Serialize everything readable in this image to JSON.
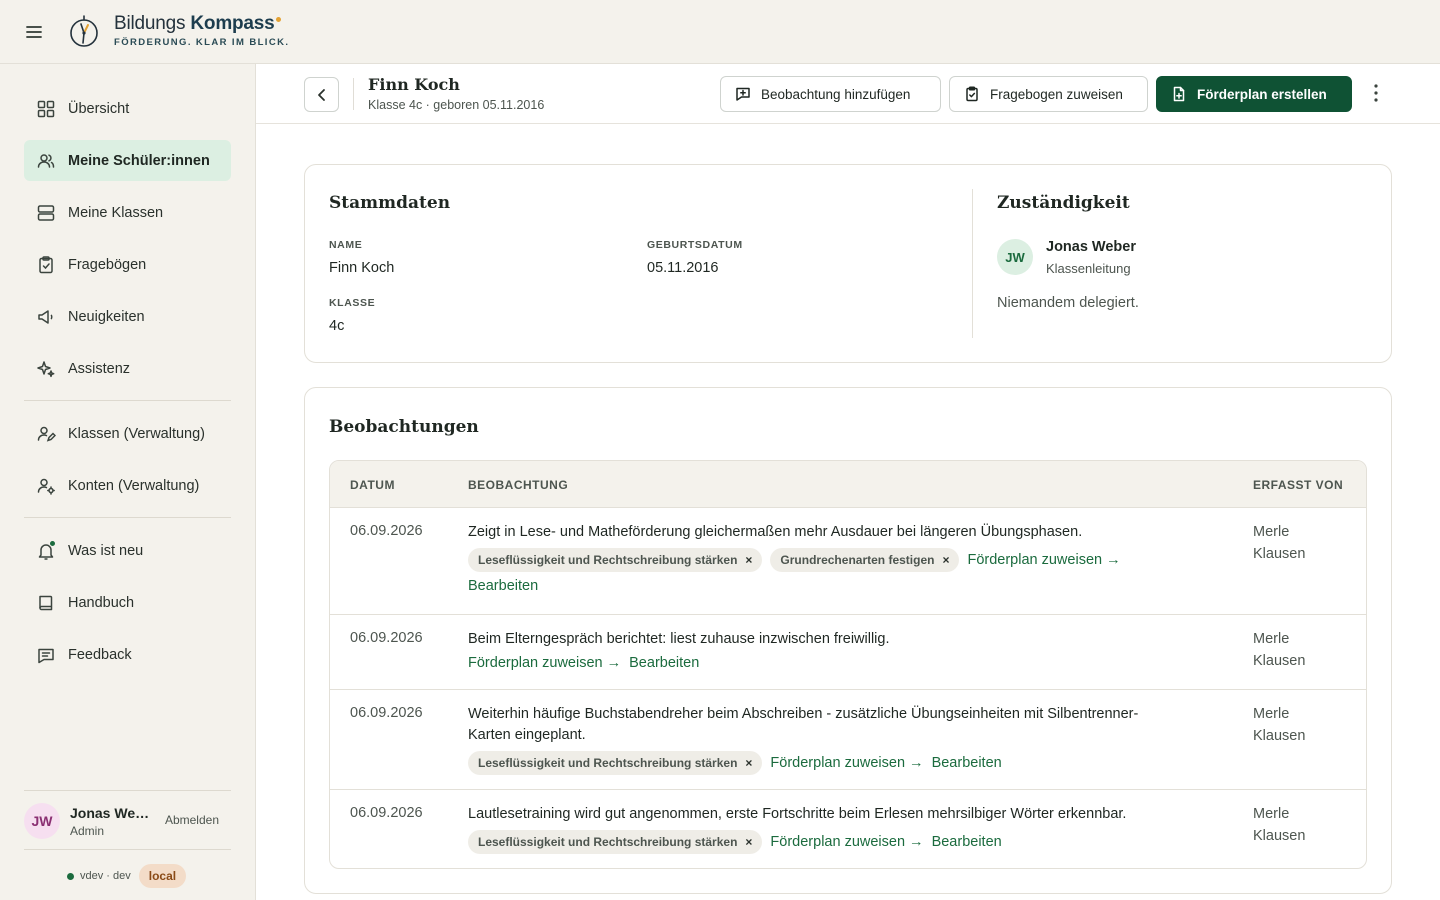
{
  "app": {
    "brand_name_regular": "Bildungs",
    "brand_name_bold": "Kompass",
    "brand_tagline": "FÖRDERUNG. KLAR IM BLICK.",
    "accent": "#0f5234"
  },
  "sidebar": {
    "items": [
      {
        "label": "Übersicht",
        "icon": "grid-icon"
      },
      {
        "label": "Meine Schüler:innen",
        "icon": "users-icon",
        "active": true
      },
      {
        "label": "Meine Klassen",
        "icon": "server-icon"
      },
      {
        "label": "Fragebögen",
        "icon": "clipboard-icon"
      },
      {
        "label": "Neuigkeiten",
        "icon": "megaphone-icon"
      },
      {
        "label": "Assistenz",
        "icon": "sparkles-icon"
      },
      {
        "label": "Klassen (Verwaltung)",
        "icon": "user-pen-icon"
      },
      {
        "label": "Konten (Verwaltung)",
        "icon": "user-cog-icon"
      },
      {
        "label": "Was ist neu",
        "icon": "bell-icon"
      },
      {
        "label": "Handbuch",
        "icon": "book-icon"
      },
      {
        "label": "Feedback",
        "icon": "message-icon"
      }
    ],
    "user": {
      "initials": "JW",
      "name": "Jonas Weber",
      "role": "Admin",
      "logout_label": "Abmelden"
    },
    "env": {
      "text": "vdev · dev",
      "badge": "local"
    }
  },
  "header": {
    "student_name": "Finn Koch",
    "student_sub": "Klasse 4c · geboren 05.11.2016",
    "btn_add_observation": "Beobachtung hinzufügen",
    "btn_assign_questionnaire": "Fragebogen zuweisen",
    "btn_create_plan": "Förderplan erstellen"
  },
  "stammdaten": {
    "title": "Stammdaten",
    "name_label": "NAME",
    "name_value": "Finn Koch",
    "birth_label": "GEBURTSDATUM",
    "birth_value": "05.11.2016",
    "class_label": "KLASSE",
    "class_value": "4c"
  },
  "zustaendigkeit": {
    "title": "Zuständigkeit",
    "initials": "JW",
    "person_name": "Jonas Weber",
    "person_role": "Klassenleitung",
    "delegation": "Niemandem delegiert."
  },
  "beobachtungen": {
    "title": "Beobachtungen",
    "columns": {
      "date": "DATUM",
      "observation": "BEOBACHTUNG",
      "by": "ERFASST VON"
    },
    "assign_link": "Förderplan zuweisen →",
    "edit_link": "Bearbeiten",
    "rows": [
      {
        "date": "06.09.2026",
        "text": "Zeigt in Lese- und Matheförderung gleichermaßen mehr Ausdauer bei längeren Übungsphasen.",
        "tags": [
          "Leseflüssigkeit und Rechtschreibung stärken",
          "Grundrechenarten festigen"
        ],
        "by": "Merle Klausen"
      },
      {
        "date": "06.09.2026",
        "text": "Beim Elterngespräch berichtet: liest zuhause inzwischen freiwillig.",
        "tags": [],
        "by": "Merle Klausen"
      },
      {
        "date": "06.09.2026",
        "text": "Weiterhin häufige Buchstabendreher beim Abschreiben - zusätzliche Übungseinheiten mit Silbentrenner-Karten eingeplant.",
        "tags": [
          "Leseflüssigkeit und Rechtschreibung stärken"
        ],
        "by": "Merle Klausen"
      },
      {
        "date": "06.09.2026",
        "text": "Lautlesetraining wird gut angenommen, erste Fortschritte beim Erlesen mehrsilbiger Wörter erkennbar.",
        "tags": [
          "Leseflüssigkeit und Rechtschreibung stärken"
        ],
        "by": "Merle Klausen"
      }
    ]
  }
}
